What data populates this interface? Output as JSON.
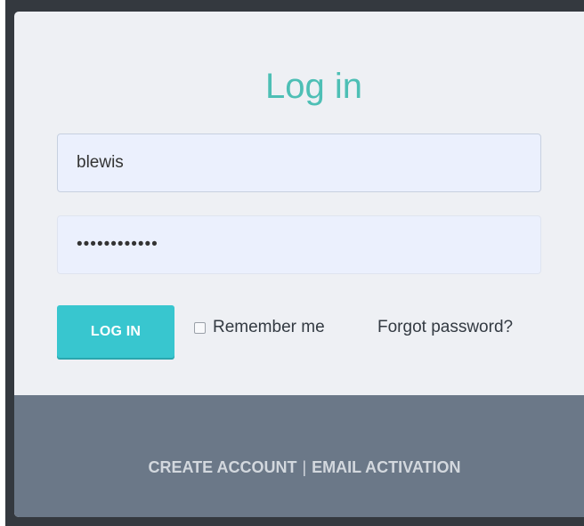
{
  "login": {
    "title": "Log in",
    "username_value": "blewis",
    "password_value": "••••••••••••",
    "login_button": "LOG IN",
    "remember_label": "Remember me",
    "forgot_label": "Forgot password?"
  },
  "footer": {
    "create_account": "CREATE ACCOUNT",
    "separator": "|",
    "email_activation": "EMAIL ACTIVATION"
  },
  "colors": {
    "title": "#4dbfb5",
    "login_button": "#38c6cf",
    "footer_bg": "#6b7888",
    "card_bg": "#eef0f4"
  }
}
